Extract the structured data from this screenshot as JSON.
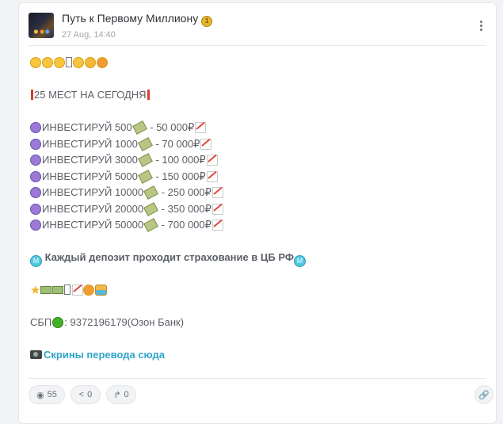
{
  "post": {
    "channel_title": "Путь к Первому Миллиону",
    "timestamp": "27 Aug, 14:40",
    "lines": {
      "headline": "25 МЕСТ НА СЕГОДНЯ",
      "invest_label": "ИНВЕСТИРУЙ",
      "offers": [
        {
          "amount": "500",
          "result": " - 50 000₽"
        },
        {
          "amount": "1000",
          "result": " - 70 000₽"
        },
        {
          "amount": "3000",
          "result": " - 100 000₽"
        },
        {
          "amount": "5000",
          "result": " - 150 000₽"
        },
        {
          "amount": "10000",
          "result": " - 250 000₽"
        },
        {
          "amount": "20000",
          "result": " - 350 000₽"
        },
        {
          "amount": "50000",
          "result": " - 700 000₽"
        }
      ],
      "insurance": " Каждый депозит проходит страхование в ЦБ РФ",
      "sbp_label": "СБП",
      "sbp_value": ": 9372196179(Озон Банк)",
      "screens_link": "Скрины перевода сюда"
    }
  },
  "footer": {
    "views": "55",
    "shares": "0",
    "forwards": "0"
  },
  "icons": {
    "views": "eye-icon",
    "shares": "share-icon",
    "forwards": "forward-icon",
    "link": "link-icon",
    "menu": "more-vertical-icon"
  },
  "colors": {
    "link": "#2fa6c8",
    "text": "#5b5f66",
    "background": "#f2f3f5"
  }
}
